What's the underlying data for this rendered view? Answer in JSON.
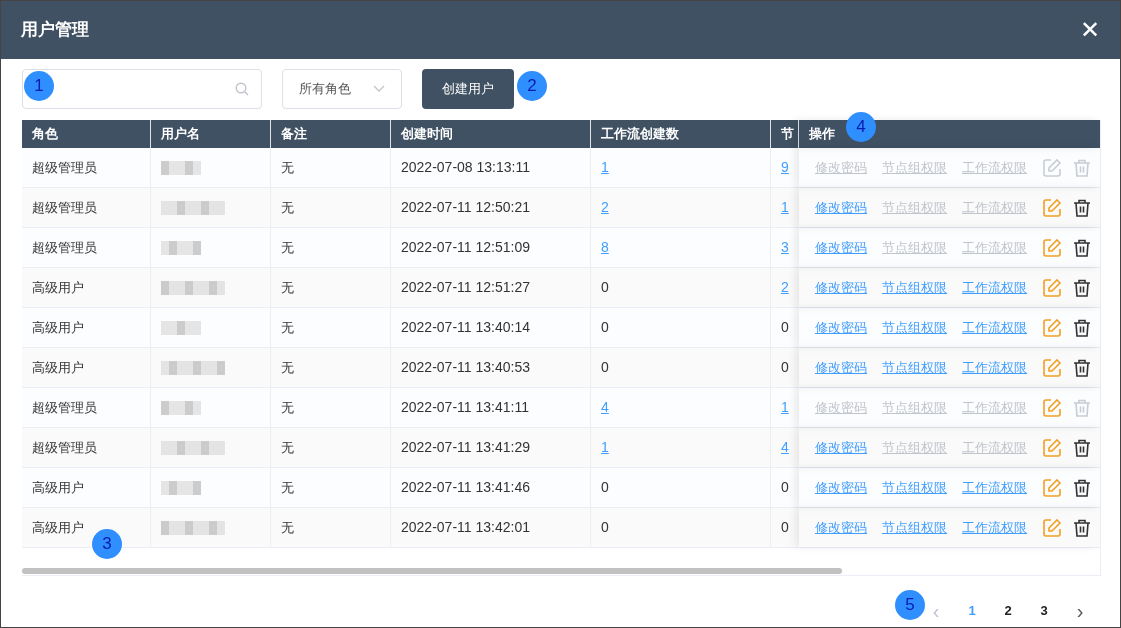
{
  "window": {
    "title": "用户管理",
    "close": "✕"
  },
  "toolbar": {
    "role_filter": "所有角色",
    "create_button": "创建用户"
  },
  "table": {
    "columns": [
      "角色",
      "用户名",
      "备注",
      "创建时间",
      "工作流创建数",
      "节",
      "操作"
    ],
    "rows": [
      {
        "role": "超级管理员",
        "note": "无",
        "created": "2022-07-08 13:13:11",
        "workflows": {
          "text": "1",
          "link": true
        },
        "column_6": {
          "text": "9",
          "link": true
        },
        "actions": [
          {
            "label": "修改密码",
            "disabled": true
          },
          {
            "label": "节点组权限",
            "disabled": true
          },
          {
            "label": "工作流权限",
            "disabled": true
          }
        ],
        "edit_disabled": true,
        "delete_disabled": true
      },
      {
        "role": "超级管理员",
        "note": "无",
        "created": "2022-07-11 12:50:21",
        "workflows": {
          "text": "2",
          "link": true
        },
        "column_6": {
          "text": "1",
          "link": true
        },
        "actions": [
          {
            "label": "修改密码",
            "disabled": false
          },
          {
            "label": "节点组权限",
            "disabled": true
          },
          {
            "label": "工作流权限",
            "disabled": true
          }
        ],
        "edit_disabled": false,
        "delete_disabled": false
      },
      {
        "role": "超级管理员",
        "note": "无",
        "created": "2022-07-11 12:51:09",
        "workflows": {
          "text": "8",
          "link": true
        },
        "column_6": {
          "text": "3",
          "link": true
        },
        "actions": [
          {
            "label": "修改密码",
            "disabled": false
          },
          {
            "label": "节点组权限",
            "disabled": true
          },
          {
            "label": "工作流权限",
            "disabled": true
          }
        ],
        "edit_disabled": false,
        "delete_disabled": false
      },
      {
        "role": "高级用户",
        "note": "无",
        "created": "2022-07-11 12:51:27",
        "workflows": {
          "text": "0",
          "link": false
        },
        "column_6": {
          "text": "2",
          "link": true
        },
        "actions": [
          {
            "label": "修改密码",
            "disabled": false
          },
          {
            "label": "节点组权限",
            "disabled": false
          },
          {
            "label": "工作流权限",
            "disabled": false
          }
        ],
        "edit_disabled": false,
        "delete_disabled": false
      },
      {
        "role": "高级用户",
        "note": "无",
        "created": "2022-07-11 13:40:14",
        "workflows": {
          "text": "0",
          "link": false
        },
        "column_6": {
          "text": "0",
          "link": false
        },
        "actions": [
          {
            "label": "修改密码",
            "disabled": false
          },
          {
            "label": "节点组权限",
            "disabled": false
          },
          {
            "label": "工作流权限",
            "disabled": false
          }
        ],
        "edit_disabled": false,
        "delete_disabled": false
      },
      {
        "role": "高级用户",
        "note": "无",
        "created": "2022-07-11 13:40:53",
        "workflows": {
          "text": "0",
          "link": false
        },
        "column_6": {
          "text": "0",
          "link": false
        },
        "actions": [
          {
            "label": "修改密码",
            "disabled": false
          },
          {
            "label": "节点组权限",
            "disabled": false
          },
          {
            "label": "工作流权限",
            "disabled": false
          }
        ],
        "edit_disabled": false,
        "delete_disabled": false
      },
      {
        "role": "超级管理员",
        "note": "无",
        "created": "2022-07-11 13:41:11",
        "workflows": {
          "text": "4",
          "link": true
        },
        "column_6": {
          "text": "1",
          "link": true
        },
        "actions": [
          {
            "label": "修改密码",
            "disabled": true
          },
          {
            "label": "节点组权限",
            "disabled": true
          },
          {
            "label": "工作流权限",
            "disabled": true
          }
        ],
        "edit_disabled": false,
        "delete_disabled": true
      },
      {
        "role": "超级管理员",
        "note": "无",
        "created": "2022-07-11 13:41:29",
        "workflows": {
          "text": "1",
          "link": true
        },
        "column_6": {
          "text": "4",
          "link": true
        },
        "actions": [
          {
            "label": "修改密码",
            "disabled": false
          },
          {
            "label": "节点组权限",
            "disabled": true
          },
          {
            "label": "工作流权限",
            "disabled": true
          }
        ],
        "edit_disabled": false,
        "delete_disabled": false
      },
      {
        "role": "高级用户",
        "note": "无",
        "created": "2022-07-11 13:41:46",
        "workflows": {
          "text": "0",
          "link": false
        },
        "column_6": {
          "text": "0",
          "link": false
        },
        "actions": [
          {
            "label": "修改密码",
            "disabled": false
          },
          {
            "label": "节点组权限",
            "disabled": false
          },
          {
            "label": "工作流权限",
            "disabled": false
          }
        ],
        "edit_disabled": false,
        "delete_disabled": false
      },
      {
        "role": "高级用户",
        "note": "无",
        "created": "2022-07-11 13:42:01",
        "workflows": {
          "text": "0",
          "link": false
        },
        "column_6": {
          "text": "0",
          "link": false
        },
        "actions": [
          {
            "label": "修改密码",
            "disabled": false
          },
          {
            "label": "节点组权限",
            "disabled": false
          },
          {
            "label": "工作流权限",
            "disabled": false
          }
        ],
        "edit_disabled": false,
        "delete_disabled": false
      }
    ]
  },
  "pagination": {
    "prev": "‹",
    "next": "›",
    "pages": [
      {
        "label": "1",
        "selected": true
      },
      {
        "label": "2",
        "selected": false
      },
      {
        "label": "3",
        "selected": false
      }
    ]
  },
  "markers": [
    "1",
    "2",
    "3",
    "4",
    "5"
  ]
}
